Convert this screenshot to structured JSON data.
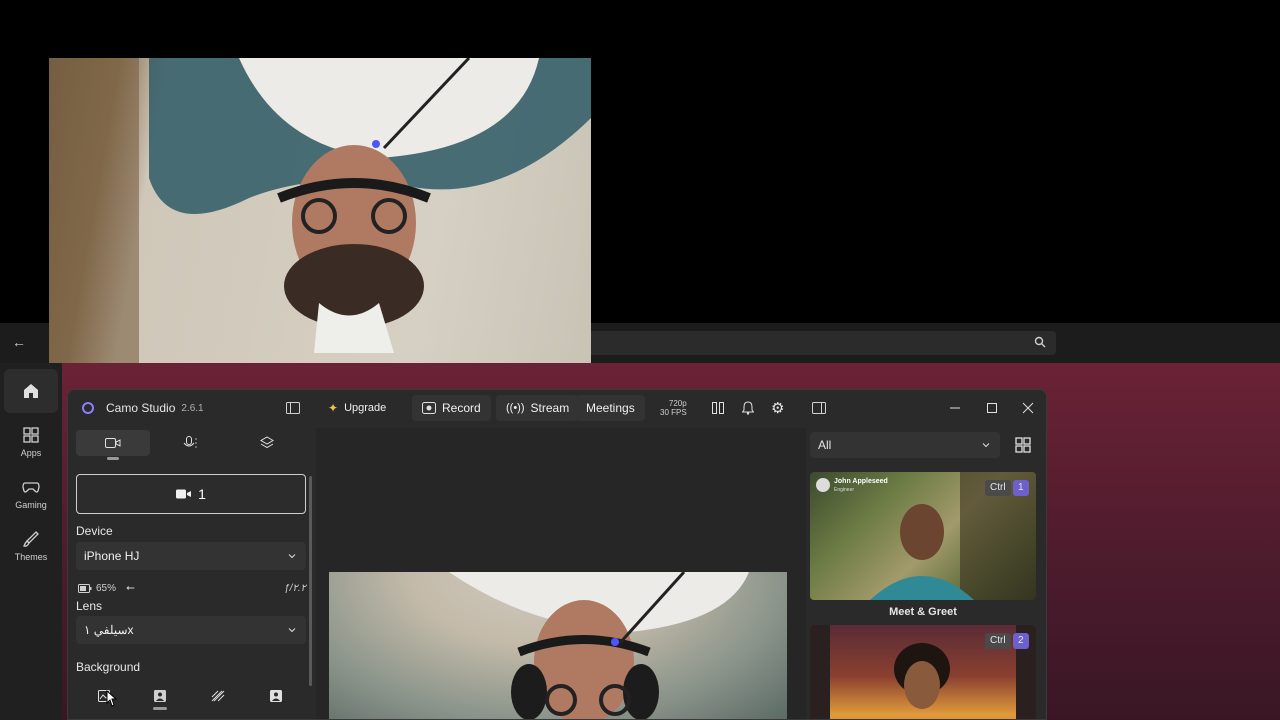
{
  "window": {
    "app_name": "Camo Studio",
    "version": "2.6.1"
  },
  "titlebar": {
    "upgrade_label": "Upgrade",
    "record_label": "Record",
    "stream_label": "Stream",
    "meetings_label": "Meetings",
    "resolution": "720p",
    "fps": "30 FPS"
  },
  "left_panel": {
    "camera_button_label": "1",
    "device_label": "Device",
    "device_value": "iPhone HJ",
    "battery": "65%",
    "aperture": "ƒ/۲.۲",
    "lens_label": "Lens",
    "lens_value": "سيلفي ۱x",
    "background_label": "Background"
  },
  "right_panel": {
    "filter_value": "All",
    "cards": [
      {
        "name": "Meet & Greet",
        "shortcut_mod": "Ctrl",
        "shortcut_key": "1",
        "overlay_name": "John Appleseed",
        "overlay_sub": "Engineer"
      },
      {
        "name": "",
        "shortcut_mod": "Ctrl",
        "shortcut_key": "2"
      }
    ]
  },
  "background_app": {
    "nav": [
      {
        "label": ""
      },
      {
        "label": "Apps"
      },
      {
        "label": "Gaming"
      },
      {
        "label": "Themes"
      }
    ]
  },
  "colors": {
    "accent": "#6d5fcc",
    "hero": "#6b2236",
    "window": "#2a2a2a"
  }
}
